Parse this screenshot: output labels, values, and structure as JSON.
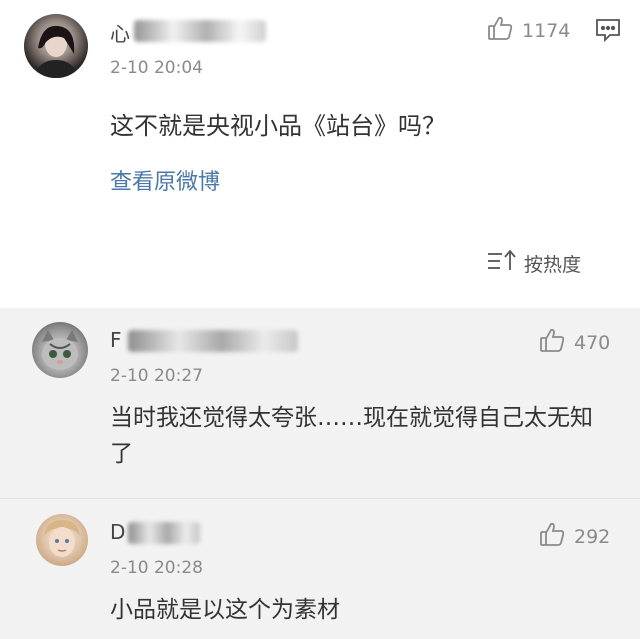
{
  "main_comment": {
    "username_visible": "心",
    "time": "2-10 20:04",
    "text": "这不就是央视小品《站台》吗？",
    "view_original": "查看原微博",
    "likes": "1174"
  },
  "sort": {
    "label": "按热度"
  },
  "replies": [
    {
      "username_visible": "F",
      "time": "2-10 20:27",
      "text": "当时我还觉得太夸张……现在就觉得自己太无知了",
      "likes": "470"
    },
    {
      "username_visible": "D",
      "time": "2-10 20:28",
      "text": "小品就是以这个为素材",
      "likes": "292"
    }
  ],
  "colors": {
    "link": "#4a78a8",
    "reply_bg": "#f2f2f2",
    "meta": "#8a8a8a"
  },
  "icons": [
    "thumb-up-icon",
    "comment-icon",
    "sort-icon"
  ]
}
